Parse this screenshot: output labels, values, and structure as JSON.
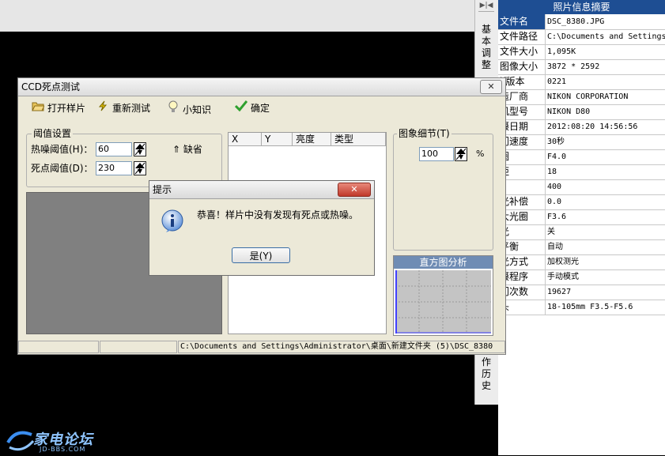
{
  "right_tabs": [
    "基本调整",
    "操作历史"
  ],
  "info_panel": {
    "title": "照片信息摘要",
    "rows": [
      {
        "key": "文件名",
        "value": "DSC_8380.JPG"
      },
      {
        "key": "文件路径",
        "value": "C:\\Documents and Settings"
      },
      {
        "key": "文件大小",
        "value": "1,095K"
      },
      {
        "key": "图像大小",
        "value": "3872 * 2592"
      },
      {
        "key": "if版本",
        "value": "0221"
      },
      {
        "key": "造厂商",
        "value": "NIKON CORPORATION"
      },
      {
        "key": "机型号",
        "value": "NIKON D80"
      },
      {
        "key": "摄日期",
        "value": "2012:08:20 14:56:56"
      },
      {
        "key": "门速度",
        "value": "30秒"
      },
      {
        "key": "圈",
        "value": "F4.0"
      },
      {
        "key": "距",
        "value": "18"
      },
      {
        "key": "0",
        "value": "400"
      },
      {
        "key": "光补偿",
        "value": "0.0"
      },
      {
        "key": "大光圈",
        "value": "F3.6"
      },
      {
        "key": "光",
        "value": "关"
      },
      {
        "key": "平衡",
        "value": "自动"
      },
      {
        "key": "光方式",
        "value": "加权测光"
      },
      {
        "key": "摄程序",
        "value": "手动模式"
      },
      {
        "key": "门次数",
        "value": "19627"
      },
      {
        "key": "头",
        "value": "18-105mm F3.5-F5.6"
      }
    ]
  },
  "main_window": {
    "title": "CCD死点测试",
    "close_label": "✕",
    "toolbar": [
      {
        "label": "打开样片",
        "icon": "folder-open-icon"
      },
      {
        "label": "重新测试",
        "icon": "lightning-icon"
      },
      {
        "label": "小知识",
        "icon": "lightbulb-icon"
      },
      {
        "label": "确定",
        "icon": "checkmark-icon"
      }
    ],
    "threshold": {
      "group_label": "阈值设置",
      "hot_label": "热噪阈值(H)：",
      "hot_value": "60",
      "dead_label": "死点阈值(D)：",
      "dead_value": "230",
      "default_label": "缺省"
    },
    "list_columns": [
      "X",
      "Y",
      "亮度",
      "类型"
    ],
    "detail": {
      "group_label": "图象细节(T)",
      "value": "100",
      "unit": "%"
    },
    "histogram_title": "直方图分析",
    "status_path": "C:\\Documents and Settings\\Administrator\\桌面\\新建文件夹 (5)\\DSC_8380"
  },
  "dialog": {
    "title": "提示",
    "close_label": "✕",
    "message": "恭喜！样片中没有发现有死点或热噪。",
    "ok_label": "是(Y)"
  },
  "logo": {
    "text": "家电论坛",
    "sub": "JD-BBS.COM"
  }
}
